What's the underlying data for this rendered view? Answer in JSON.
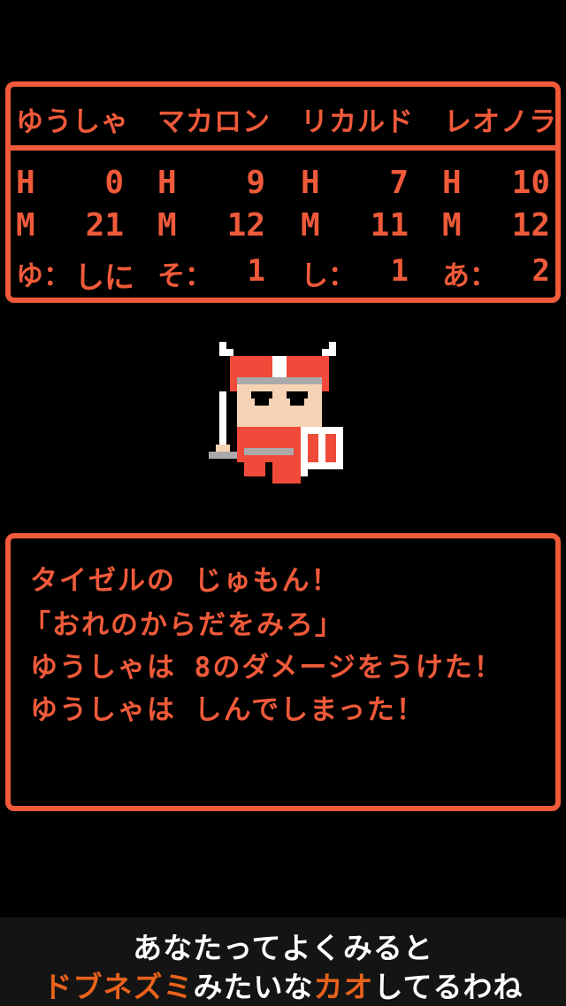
{
  "party": [
    {
      "name": "ゆうしゃ",
      "hp_label": "H",
      "hp": "0",
      "mp_label": "M",
      "mp": "21",
      "cond_label": "ゆ：",
      "cond": "しに"
    },
    {
      "name": "マカロン",
      "hp_label": "H",
      "hp": "9",
      "mp_label": "M",
      "mp": "12",
      "cond_label": "そ：",
      "cond": "1"
    },
    {
      "name": "リカルド",
      "hp_label": "H",
      "hp": "7",
      "mp_label": "M",
      "mp": "11",
      "cond_label": "し：",
      "cond": "1"
    },
    {
      "name": "レオノラ",
      "hp_label": "H",
      "hp": "10",
      "mp_label": "M",
      "mp": "12",
      "cond_label": "あ：",
      "cond": "2"
    }
  ],
  "message": {
    "lines": [
      "タイゼルの じゅもん！",
      "「おれのからだをみろ」",
      "ゆうしゃは 8のダメージをうけた！",
      "ゆうしゃは しんでしまった！"
    ]
  },
  "caption": {
    "line1": "あなたってよくみると",
    "line2_highlight1": "ドブネズミ",
    "line2_text1": "みたいな",
    "line2_highlight2": "カオ",
    "line2_text2": "してるわね"
  },
  "colors": {
    "accent": "#ef5a3a",
    "background": "#000000",
    "caption_highlight": "#e8621c"
  }
}
